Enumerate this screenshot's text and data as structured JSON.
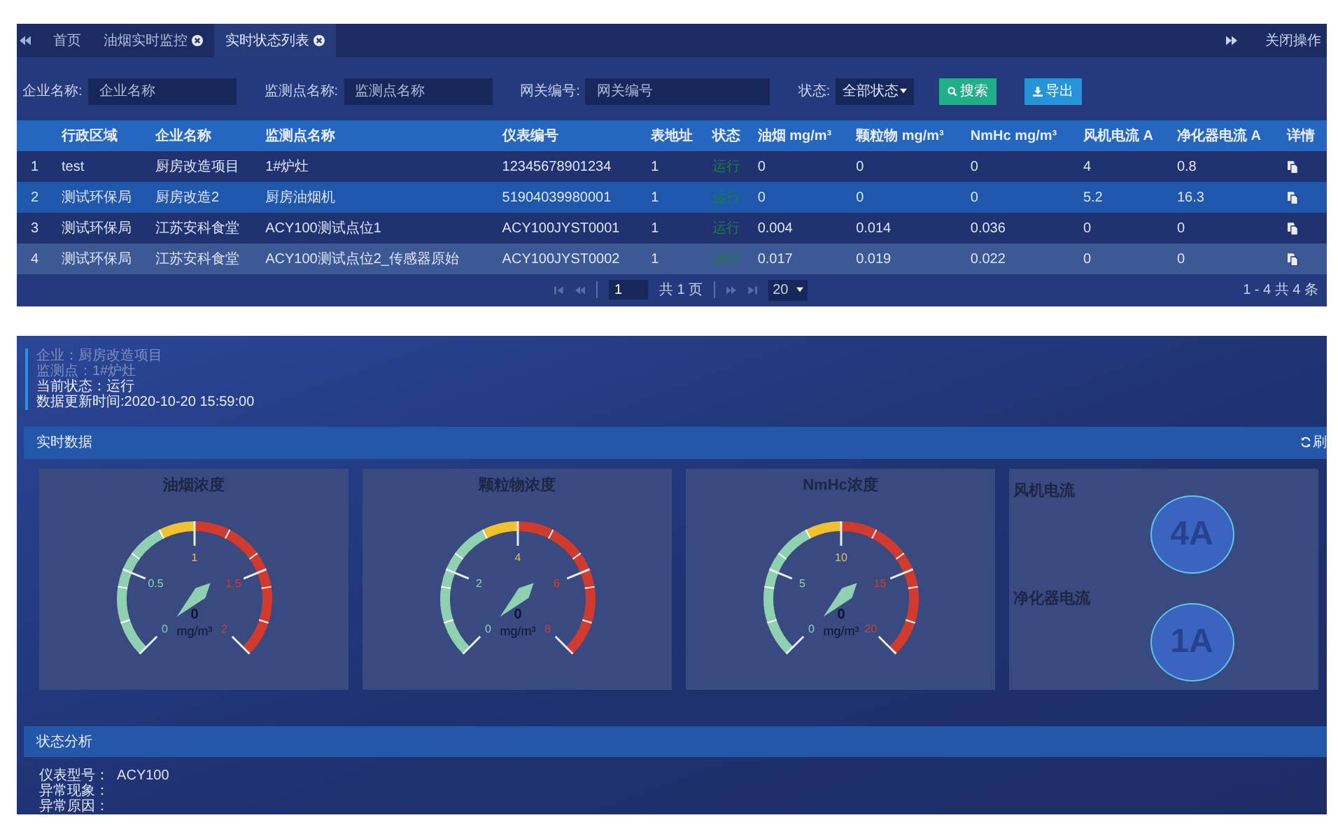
{
  "tabs_bar": {
    "tabs": [
      {
        "label": "首页",
        "closable": false,
        "selected": false
      },
      {
        "label": "油烟实时监控",
        "closable": true,
        "selected": false
      },
      {
        "label": "实时状态列表",
        "closable": true,
        "selected": true
      }
    ],
    "close_menu": "关闭操作"
  },
  "filters": [
    {
      "label": "企业名称:",
      "placeholder": "企业名称"
    },
    {
      "label": "监测点名称:",
      "placeholder": "监测点名称"
    },
    {
      "label": "网关编号:",
      "placeholder": "网关编号"
    }
  ],
  "status_filter": {
    "label": "状态:",
    "value": "全部状态"
  },
  "buttons": [
    {
      "kind": "search",
      "label": "搜索"
    },
    {
      "kind": "export",
      "label": "导出"
    }
  ],
  "table": {
    "columns": [
      "行政区域",
      "企业名称",
      "监测点名称",
      "仪表编号",
      "表地址",
      "状态",
      "油烟 mg/m³",
      "颗粒物 mg/m³",
      "NmHc mg/m³",
      "风机电流 A",
      "净化器电流 A",
      "详情"
    ],
    "rows": [
      {
        "index": "1",
        "cells": [
          "test",
          "厨房改造项目",
          "1#炉灶",
          "12345678901234",
          "1",
          "运行",
          "0",
          "0",
          "0",
          "4",
          "0.8"
        ],
        "selected": false,
        "hovered": false
      },
      {
        "index": "2",
        "cells": [
          "测试环保局",
          "厨房改造2",
          "厨房油烟机",
          "51904039980001",
          "1",
          "运行",
          "0",
          "0",
          "0",
          "5.2",
          "16.3"
        ],
        "selected": true,
        "hovered": false
      },
      {
        "index": "3",
        "cells": [
          "测试环保局",
          "江苏安科食堂",
          "ACY100测试点位1",
          "ACY100JYST0001",
          "1",
          "运行",
          "0.004",
          "0.014",
          "0.036",
          "0",
          "0"
        ],
        "selected": false,
        "hovered": false
      },
      {
        "index": "4",
        "cells": [
          "测试环保局",
          "江苏安科食堂",
          "ACY100测试点位2_传感器原始",
          "ACY100JYST0002",
          "1",
          "运行",
          "0.017",
          "0.019",
          "0.022",
          "0",
          "0"
        ],
        "selected": false,
        "hovered": true
      }
    ]
  },
  "pagination": {
    "page": "1",
    "total_pages": "共 1 页",
    "page_size": "20",
    "summary": "1 - 4  共 4 条"
  },
  "detail": {
    "info": [
      {
        "text": "企业：厨房改造项目",
        "muted": true
      },
      {
        "text": "监测点：1#炉灶",
        "muted": true
      },
      {
        "text": "当前状态：运行",
        "muted": false
      },
      {
        "text": "数据更新时间:2020-10-20 15:59:00",
        "muted": false
      }
    ],
    "realtime": {
      "title": "实时数据",
      "refresh": "刷"
    },
    "gauges": [
      {
        "title": "油烟浓度",
        "ticks": [
          "0",
          "0.5",
          "1",
          "1.5",
          "2"
        ],
        "value": "0",
        "unit": "mg/m³"
      },
      {
        "title": "颗粒物浓度",
        "ticks": [
          "0",
          "2",
          "4",
          "6",
          "8"
        ],
        "value": "0",
        "unit": "mg/m³"
      },
      {
        "title": "NmHc浓度",
        "ticks": [
          "0",
          "5",
          "10",
          "15",
          "20"
        ],
        "value": "0",
        "unit": "mg/m³"
      }
    ],
    "currents": [
      {
        "label": "风机电流",
        "value": "4A"
      },
      {
        "label": "净化器电流",
        "value": "1A"
      }
    ],
    "analysis": {
      "title": "状态分析",
      "lines": [
        "仪表型号：  ACY100",
        "异常现象：",
        "异常原因："
      ]
    }
  }
}
